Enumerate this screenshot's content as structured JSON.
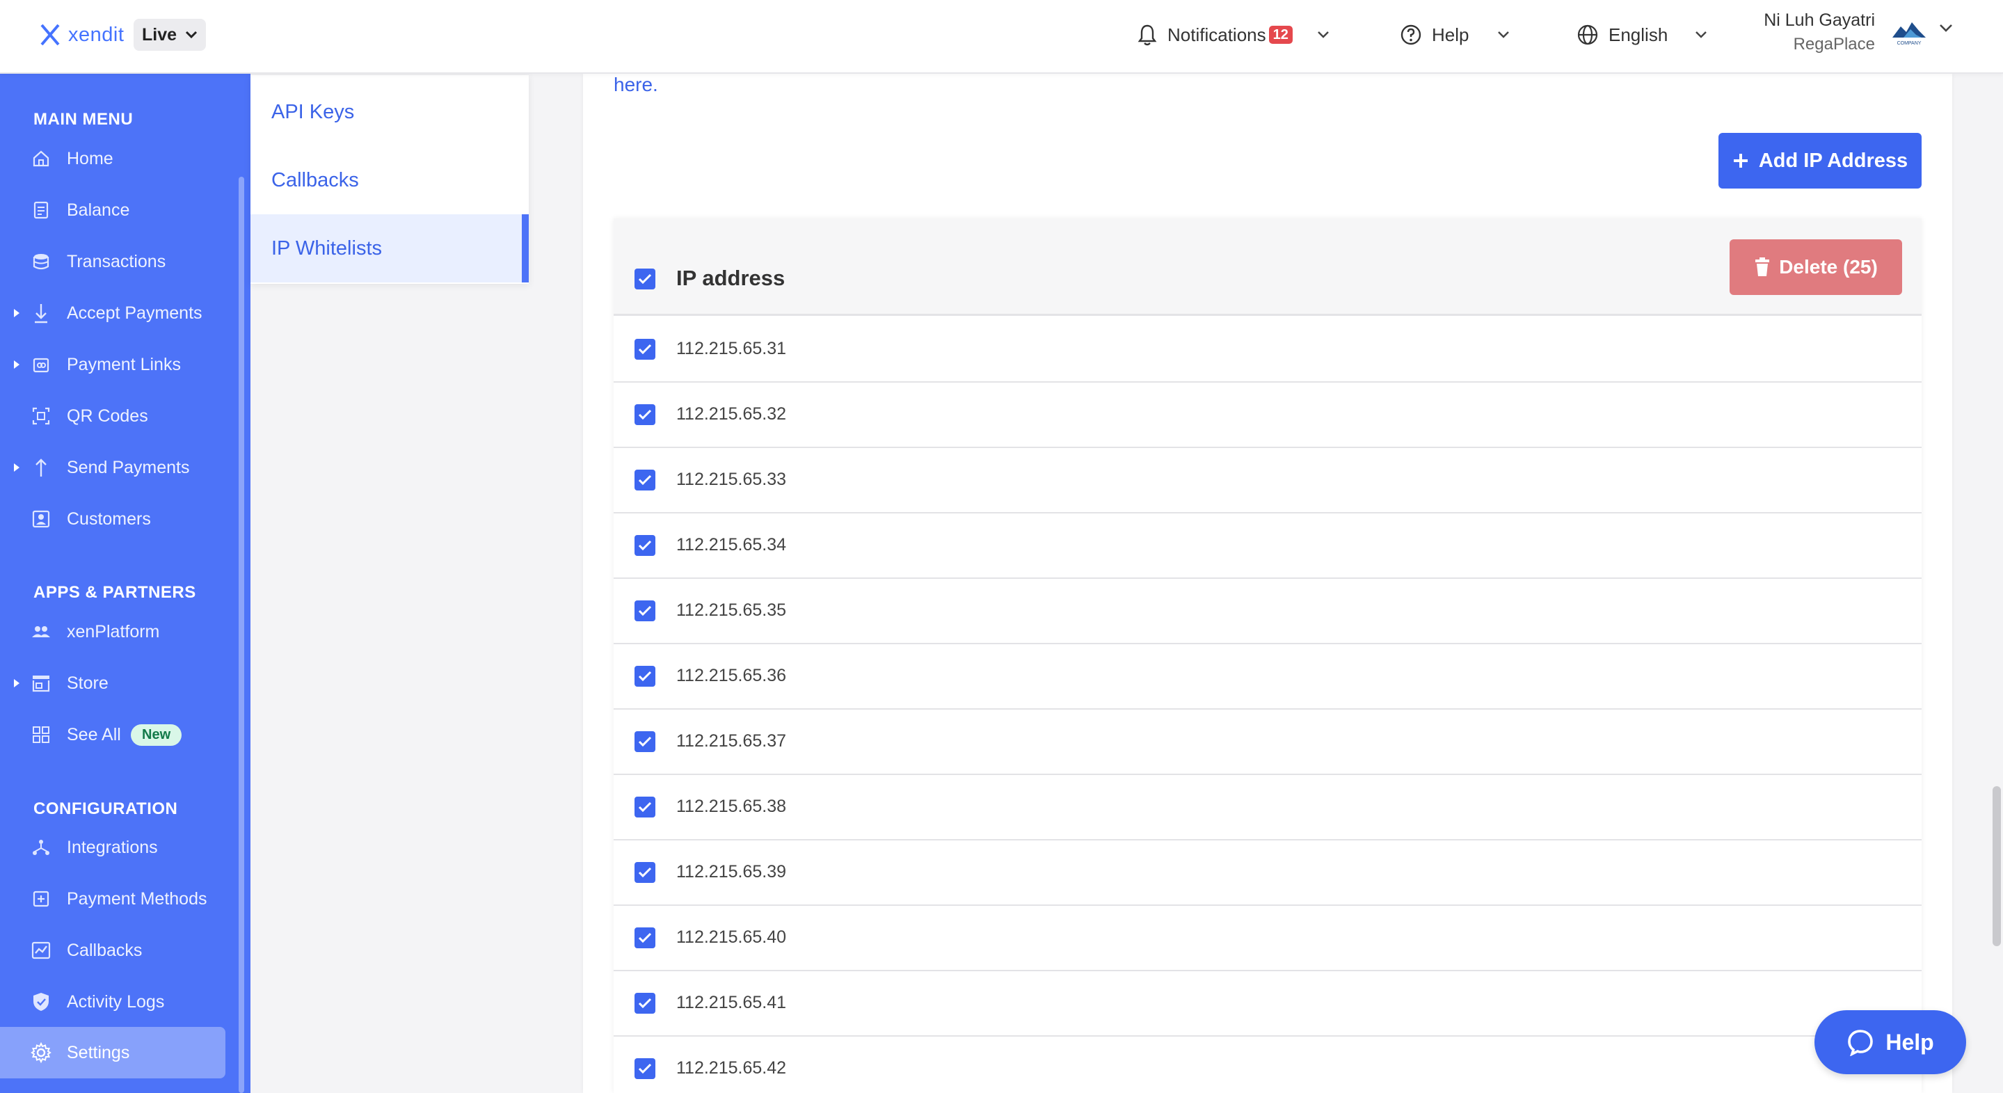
{
  "topbar": {
    "logo_text": "xendit",
    "environment": "Live",
    "notifications_label": "Notifications",
    "notifications_count": "12",
    "help_label": "Help",
    "language_label": "English",
    "user_name": "Ni Luh Gayatri",
    "company_name": "RegaPlace",
    "company_logo_text": "COMPANY"
  },
  "sidebar": {
    "main_menu_heading": "MAIN MENU",
    "main_items": [
      {
        "label": "Home",
        "icon": "home-icon"
      },
      {
        "label": "Balance",
        "icon": "balance-icon"
      },
      {
        "label": "Transactions",
        "icon": "transactions-icon"
      },
      {
        "label": "Accept Payments",
        "icon": "accept-payments-icon"
      },
      {
        "label": "Payment Links",
        "icon": "payment-links-icon"
      },
      {
        "label": "QR Codes",
        "icon": "qr-code-icon"
      },
      {
        "label": "Send Payments",
        "icon": "send-payments-icon"
      },
      {
        "label": "Customers",
        "icon": "customers-icon"
      }
    ],
    "apps_heading": "APPS & PARTNERS",
    "apps_items": [
      {
        "label": "xenPlatform",
        "icon": "xenplatform-icon"
      },
      {
        "label": "Store",
        "icon": "store-icon"
      },
      {
        "label": "See All",
        "icon": "grid-icon",
        "badge": "New"
      }
    ],
    "config_heading": "CONFIGURATION",
    "config_items": [
      {
        "label": "Integrations",
        "icon": "integrations-icon"
      },
      {
        "label": "Payment Methods",
        "icon": "payment-methods-icon"
      },
      {
        "label": "Callbacks",
        "icon": "callbacks-icon"
      },
      {
        "label": "Activity Logs",
        "icon": "shield-icon"
      },
      {
        "label": "Settings",
        "icon": "gear-icon"
      }
    ]
  },
  "submenu": {
    "items": [
      "API Keys",
      "Callbacks",
      "IP Whitelists"
    ],
    "active": "IP Whitelists"
  },
  "main": {
    "here_link": "here.",
    "add_button_label": "Add IP Address",
    "table_header": "IP address",
    "delete_button_label": "Delete (25)",
    "rows": [
      "112.215.65.31",
      "112.215.65.32",
      "112.215.65.33",
      "112.215.65.34",
      "112.215.65.35",
      "112.215.65.36",
      "112.215.65.37",
      "112.215.65.38",
      "112.215.65.39",
      "112.215.65.40",
      "112.215.65.41",
      "112.215.65.42"
    ]
  },
  "help_fab_label": "Help",
  "colors": {
    "brand": "#4d73f8",
    "primary_button": "#3d66f0",
    "delete_button": "#e07b7f",
    "badge": "#e5484d",
    "link": "#3b63e8"
  }
}
